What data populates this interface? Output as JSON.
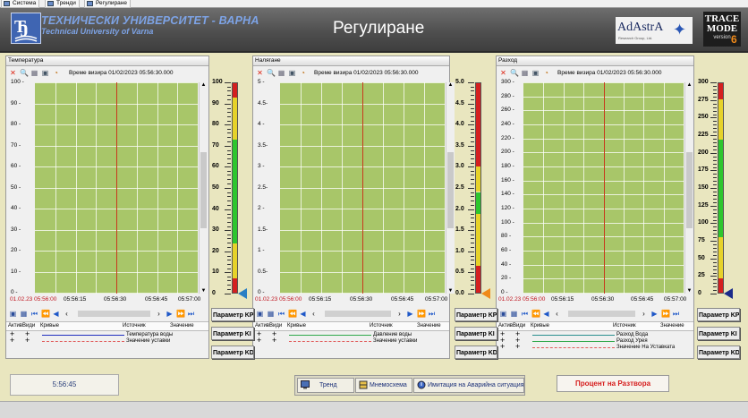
{
  "tabs": [
    "Система",
    "Тренди",
    "Регулиране"
  ],
  "header": {
    "university_bg": "ТЕХНИЧЕСКИ УНИВЕРСИТЕТ - ВАРНА",
    "university_en": "Technical University of Varna",
    "title": "Регулиране",
    "adastra_name": "AdAstrA",
    "adastra_sub": "Research Group, Ltd.",
    "trace_line1": "TRACE",
    "trace_line2": "MODE",
    "trace_version": "version",
    "trace_version_num": "6"
  },
  "trends": [
    {
      "title": "Температура",
      "sight_time": "Време визира 01/02/2023 05:56:30.000",
      "y_ticks": [
        "100 -",
        "90 -",
        "80 -",
        "70 -",
        "60 -",
        "50 -",
        "40 -",
        "30 -",
        "20 -",
        "10 -",
        "0 -"
      ],
      "x_ticks": [
        "01.02.23 05:56:00",
        "05:56:15",
        "05:56:30",
        "05:56:45",
        "05:57:00"
      ],
      "legend_headers": [
        "Актив",
        "Види",
        "Кривые",
        "Источник",
        "Значение"
      ],
      "legend_items": [
        {
          "name": "Температура воды",
          "color": "#1f2fbf",
          "style": "solid"
        },
        {
          "name": "Значение уставки",
          "color": "#e05a5a",
          "style": "dashed"
        }
      ]
    },
    {
      "title": "Налягане",
      "sight_time": "Време визира 01/02/2023 05:56:30.000",
      "y_ticks": [
        "5 -",
        "4.5-",
        "4 -",
        "3.5-",
        "3 -",
        "2.5-",
        "2 -",
        "1.5-",
        "1 -",
        "0.5-",
        "0 -"
      ],
      "x_ticks": [
        "01.02.23 05:56:00",
        "05:56:15",
        "05:56:30",
        "05:56:45",
        "05:57:00"
      ],
      "legend_headers": [
        "Актив",
        "Види",
        "Кривые",
        "Источник",
        "Значение"
      ],
      "legend_items": [
        {
          "name": "Давление воды",
          "color": "#2fa84a",
          "style": "solid"
        },
        {
          "name": "Значение уставки",
          "color": "#e05a5a",
          "style": "dashed"
        }
      ]
    },
    {
      "title": "Разход",
      "sight_time": "Време визира 01/02/2023 05:56:30.000",
      "y_ticks": [
        "300 -",
        "280 -",
        "260 -",
        "240 -",
        "220 -",
        "200 -",
        "180 -",
        "160 -",
        "140 -",
        "120 -",
        "100 -",
        "80 -",
        "60 -",
        "40 -",
        "20 -",
        "0 -"
      ],
      "x_ticks": [
        "01.02.23 05:56:00",
        "05:56:15",
        "05:56:30",
        "05:56:45",
        "05:57:00"
      ],
      "legend_headers": [
        "Актив",
        "Види",
        "Кривые",
        "Источник",
        "Значение"
      ],
      "legend_items": [
        {
          "name": "Разход Вода",
          "color": "#2a8f8f",
          "style": "solid"
        },
        {
          "name": "Разход Урея",
          "color": "#2fa84a",
          "style": "solid"
        },
        {
          "name": "Значение На Уставката",
          "color": "#e05a5a",
          "style": "dashed"
        }
      ]
    }
  ],
  "gauges": [
    {
      "labels": [
        "100",
        "90",
        "80",
        "70",
        "60",
        "50",
        "40",
        "30",
        "20",
        "10",
        "0"
      ],
      "value_fraction": 0.0,
      "zones": [
        {
          "from": 0.0,
          "to": 0.07,
          "color": "#d42020"
        },
        {
          "from": 0.07,
          "to": 0.24,
          "color": "#e6d22a"
        },
        {
          "from": 0.24,
          "to": 0.73,
          "color": "#2ec62e"
        },
        {
          "from": 0.73,
          "to": 0.93,
          "color": "#e6d22a"
        },
        {
          "from": 0.93,
          "to": 1.0,
          "color": "#d42020"
        }
      ],
      "pointer_color": "#2a7fc4"
    },
    {
      "labels": [
        "5.0",
        "4.5",
        "4.0",
        "3.5",
        "3.0",
        "2.5",
        "2.0",
        "1.5",
        "1.0",
        "0.5",
        "0.0"
      ],
      "value_fraction": 0.0,
      "zones": [
        {
          "from": 0.0,
          "to": 0.13,
          "color": "#d42020"
        },
        {
          "from": 0.13,
          "to": 0.38,
          "color": "#e6d22a"
        },
        {
          "from": 0.38,
          "to": 0.48,
          "color": "#2ec62e"
        },
        {
          "from": 0.48,
          "to": 0.6,
          "color": "#e6d22a"
        },
        {
          "from": 0.6,
          "to": 1.0,
          "color": "#d42020"
        }
      ],
      "pointer_color": "#f08a1a"
    },
    {
      "labels": [
        "300",
        "275",
        "250",
        "225",
        "200",
        "175",
        "150",
        "125",
        "100",
        "75",
        "50",
        "25",
        "0"
      ],
      "value_fraction": 0.0,
      "zones": [
        {
          "from": 0.0,
          "to": 0.07,
          "color": "#d42020"
        },
        {
          "from": 0.07,
          "to": 0.27,
          "color": "#e6d22a"
        },
        {
          "from": 0.27,
          "to": 0.73,
          "color": "#2ec62e"
        },
        {
          "from": 0.73,
          "to": 0.92,
          "color": "#e6d22a"
        },
        {
          "from": 0.92,
          "to": 1.0,
          "color": "#d42020"
        }
      ],
      "pointer_color": "#1a2a8a"
    }
  ],
  "params": [
    [
      "Параметр KP",
      "Параметр KI",
      "Параметр KD"
    ],
    [
      "Параметр KP",
      "Параметр KI",
      "Параметр KD"
    ],
    [
      "Параметр KP",
      "Параметр KI",
      "Параметр KD"
    ]
  ],
  "bottom": {
    "clock": "5:56:45",
    "buttons": [
      "Тренд",
      "Мнемосхема",
      "Имитация на Аварийна ситуация"
    ],
    "percent_button": "Процент на Разтвора"
  }
}
